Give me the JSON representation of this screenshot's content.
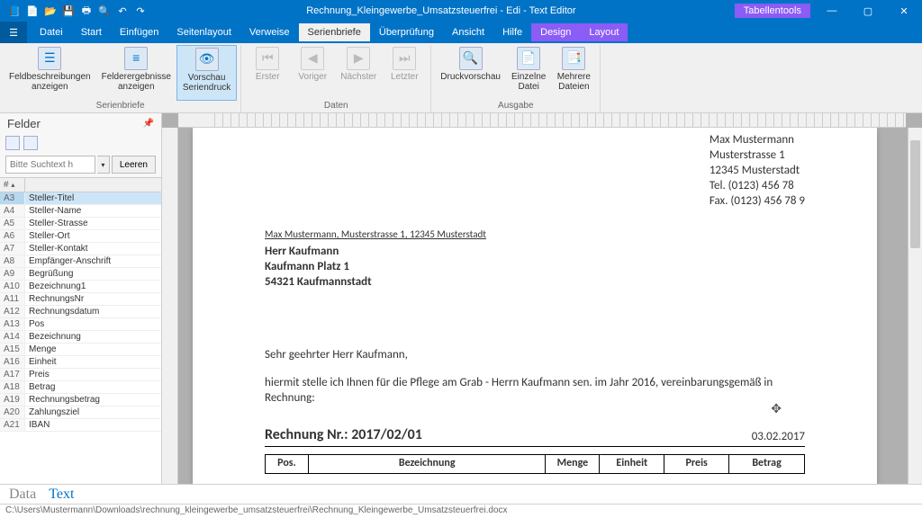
{
  "window": {
    "title": "Rechnung_Kleingewerbe_Umsatzsteuerfrei - Edi - Text Editor",
    "context_tab": "Tabellentools"
  },
  "menu": {
    "tabs": [
      "Datei",
      "Start",
      "Einfügen",
      "Seitenlayout",
      "Verweise",
      "Serienbriefe",
      "Überprüfung",
      "Ansicht",
      "Hilfe"
    ],
    "active": "Serienbriefe",
    "context_tabs": [
      "Design",
      "Layout"
    ]
  },
  "ribbon": {
    "groups": [
      {
        "label": "Serienbriefe",
        "buttons": [
          {
            "label": "Feldbeschreibungen\nanzeigen",
            "icon": "☰",
            "state": "normal"
          },
          {
            "label": "Felderergebnisse\nanzeigen",
            "icon": "≡",
            "state": "normal"
          },
          {
            "label": "Vorschau\nSeriendruck",
            "icon": "👁",
            "state": "active"
          }
        ]
      },
      {
        "label": "Daten",
        "buttons": [
          {
            "label": "Erster",
            "icon": "⏮",
            "state": "disabled"
          },
          {
            "label": "Voriger",
            "icon": "◀",
            "state": "disabled"
          },
          {
            "label": "Nächster",
            "icon": "▶",
            "state": "disabled"
          },
          {
            "label": "Letzter",
            "icon": "⏭",
            "state": "disabled"
          }
        ]
      },
      {
        "label": "Ausgabe",
        "buttons": [
          {
            "label": "Druckvorschau",
            "icon": "🔍",
            "state": "normal"
          },
          {
            "label": "Einzelne\nDatei",
            "icon": "📄",
            "state": "normal"
          },
          {
            "label": "Mehrere\nDateien",
            "icon": "📑",
            "state": "normal"
          }
        ]
      }
    ]
  },
  "fields": {
    "title": "Felder",
    "search_placeholder": "Bitte Suchtext h",
    "clear_btn": "Leeren",
    "col1": "#",
    "col2": "",
    "rows": [
      {
        "id": "A3",
        "name": "Steller-Titel",
        "selected": true
      },
      {
        "id": "A4",
        "name": "Steller-Name"
      },
      {
        "id": "A5",
        "name": "Steller-Strasse"
      },
      {
        "id": "A6",
        "name": "Steller-Ort"
      },
      {
        "id": "A7",
        "name": "Steller-Kontakt"
      },
      {
        "id": "A8",
        "name": "Empfänger-Anschrift"
      },
      {
        "id": "A9",
        "name": "Begrüßung"
      },
      {
        "id": "A10",
        "name": "Bezeichnung1"
      },
      {
        "id": "A11",
        "name": "RechnungsNr"
      },
      {
        "id": "A12",
        "name": "Rechnungsdatum"
      },
      {
        "id": "A13",
        "name": "Pos"
      },
      {
        "id": "A14",
        "name": "Bezeichnung"
      },
      {
        "id": "A15",
        "name": "Menge"
      },
      {
        "id": "A16",
        "name": "Einheit"
      },
      {
        "id": "A17",
        "name": "Preis"
      },
      {
        "id": "A18",
        "name": "Betrag"
      },
      {
        "id": "A19",
        "name": "Rechnungsbetrag"
      },
      {
        "id": "A20",
        "name": "Zahlungsziel"
      },
      {
        "id": "A21",
        "name": "IBAN"
      }
    ]
  },
  "document": {
    "sender": {
      "name": "Max Mustermann",
      "street": "Musterstrasse 1",
      "city": "12345 Musterstadt",
      "tel": "Tel. (0123) 456 78",
      "fax": "Fax. (0123) 456 78 9"
    },
    "sender_line": "Max Mustermann, Musterstrasse 1, 12345 Musterstadt",
    "recipient": {
      "name": "Herr Kaufmann",
      "street": "Kaufmann Platz 1",
      "city": "54321 Kaufmannstadt"
    },
    "greeting": "Sehr geehrter Herr Kaufmann,",
    "body": "hiermit stelle ich Ihnen für die Pflege am Grab - Herrn Kaufmann sen. im Jahr 2016, vereinbarungsgemäß in Rechnung:",
    "invoice_label": "Rechnung Nr.: 2017/02/01",
    "invoice_date": "03.02.2017",
    "table_headers": [
      "Pos.",
      "Bezeichnung",
      "Menge",
      "Einheit",
      "Preis",
      "Betrag"
    ]
  },
  "bottom_tabs": {
    "data": "Data",
    "text": "Text"
  },
  "statusbar": "C:\\Users\\Mustermann\\Downloads\\rechnung_kleingewerbe_umsatzsteuerfrei\\Rechnung_Kleingewerbe_Umsatzsteuerfrei.docx"
}
